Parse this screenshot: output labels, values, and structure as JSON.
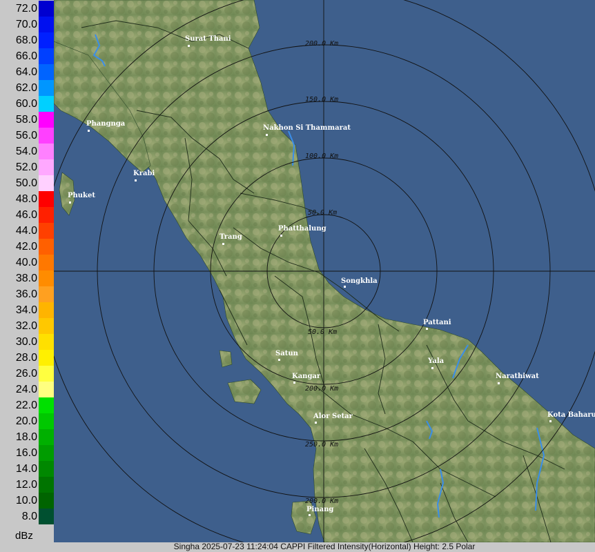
{
  "legend": {
    "unit": "dBz",
    "levels": [
      {
        "value": "72.0",
        "color": "#0000d0"
      },
      {
        "value": "70.0",
        "color": "#0010f0"
      },
      {
        "value": "68.0",
        "color": "#0020ff"
      },
      {
        "value": "66.0",
        "color": "#0040ff"
      },
      {
        "value": "64.0",
        "color": "#0064ff"
      },
      {
        "value": "62.0",
        "color": "#0096ff"
      },
      {
        "value": "60.0",
        "color": "#00d0ff"
      },
      {
        "value": "58.0",
        "color": "#ff00ff"
      },
      {
        "value": "56.0",
        "color": "#ff40ff"
      },
      {
        "value": "54.0",
        "color": "#ff80ff"
      },
      {
        "value": "52.0",
        "color": "#ffa8ff"
      },
      {
        "value": "50.0",
        "color": "#ffd0ff"
      },
      {
        "value": "48.0",
        "color": "#ff0000"
      },
      {
        "value": "46.0",
        "color": "#ff2000"
      },
      {
        "value": "44.0",
        "color": "#ff4000"
      },
      {
        "value": "42.0",
        "color": "#ff6000"
      },
      {
        "value": "40.0",
        "color": "#ff7800"
      },
      {
        "value": "38.0",
        "color": "#ff8c00"
      },
      {
        "value": "36.0",
        "color": "#ffa020"
      },
      {
        "value": "34.0",
        "color": "#ffb400"
      },
      {
        "value": "32.0",
        "color": "#ffc800"
      },
      {
        "value": "30.0",
        "color": "#ffe000"
      },
      {
        "value": "28.0",
        "color": "#fff000"
      },
      {
        "value": "26.0",
        "color": "#ffff40"
      },
      {
        "value": "24.0",
        "color": "#ffff80"
      },
      {
        "value": "22.0",
        "color": "#00e000"
      },
      {
        "value": "20.0",
        "color": "#00c800"
      },
      {
        "value": "18.0",
        "color": "#00b000"
      },
      {
        "value": "16.0",
        "color": "#009c00"
      },
      {
        "value": "14.0",
        "color": "#008800"
      },
      {
        "value": "12.0",
        "color": "#007400"
      },
      {
        "value": "10.0",
        "color": "#006400"
      },
      {
        "value": "8.0",
        "color": "#005030"
      }
    ]
  },
  "map": {
    "sea_color": "#3e5f8c",
    "land_color": "#8a9a66",
    "range_labels": [
      "50.0 Km",
      "100.0 Km",
      "150.0 Km",
      "200.0 Km",
      "50.0 Km",
      "200.0 Km",
      "250.0 Km",
      "200.0 Km"
    ],
    "cities": [
      {
        "name": "Surat Thani"
      },
      {
        "name": "Phangnga"
      },
      {
        "name": "Nakhon Si Thammarat"
      },
      {
        "name": "Krabi"
      },
      {
        "name": "Phuket"
      },
      {
        "name": "Phatthalung"
      },
      {
        "name": "Trang"
      },
      {
        "name": "Songkhla"
      },
      {
        "name": "Pattani"
      },
      {
        "name": "Satun"
      },
      {
        "name": "Yala"
      },
      {
        "name": "Narathiwat"
      },
      {
        "name": "Kangar"
      },
      {
        "name": "Alor Setar"
      },
      {
        "name": "Kota Baharu"
      },
      {
        "name": "Pinang"
      }
    ]
  },
  "footer": {
    "caption": "Singha 2025-07-23 11:24:04 CAPPI Filtered Intensity(Horizontal)  Height: 2.5 Polar"
  }
}
